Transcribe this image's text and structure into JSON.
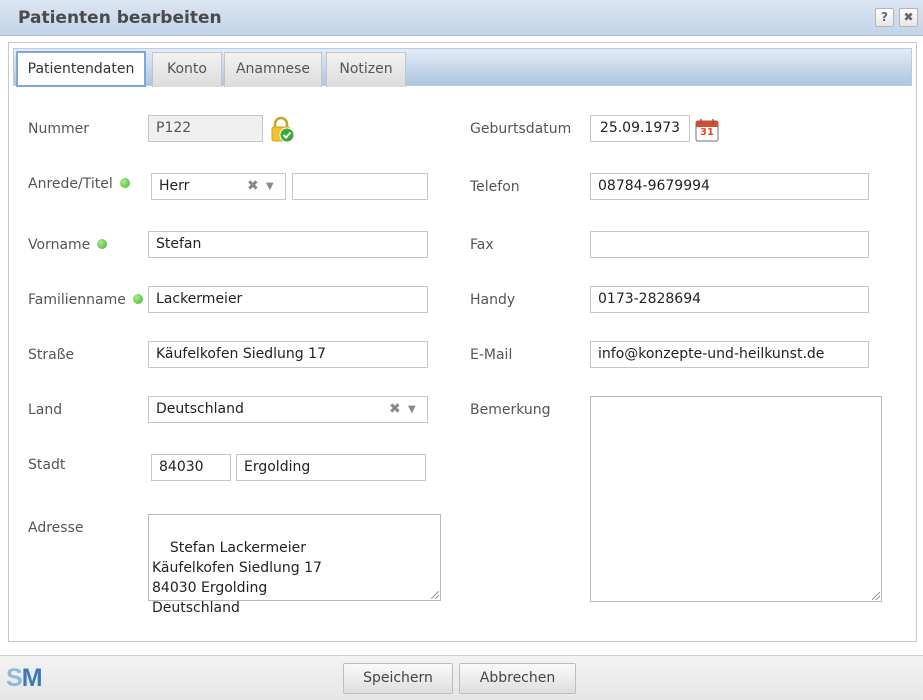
{
  "window": {
    "title": "Patienten bearbeiten",
    "help_label": "?",
    "close_label": "✖"
  },
  "tabs": [
    {
      "label": "Patientendaten",
      "active": true
    },
    {
      "label": "Konto",
      "active": false
    },
    {
      "label": "Anamnese",
      "active": false
    },
    {
      "label": "Notizen",
      "active": false
    }
  ],
  "form": {
    "nummer": {
      "label": "Nummer",
      "value": "P122"
    },
    "anrede": {
      "label": "Anrede/Titel",
      "value": "Herr",
      "titel_value": ""
    },
    "vorname": {
      "label": "Vorname",
      "value": "Stefan"
    },
    "familienname": {
      "label": "Familienname",
      "value": "Lackermeier"
    },
    "strasse": {
      "label": "Straße",
      "value": "Käufelkofen Siedlung 17"
    },
    "land": {
      "label": "Land",
      "value": "Deutschland"
    },
    "stadt": {
      "label": "Stadt",
      "plz": "84030",
      "ort": "Ergolding"
    },
    "adresse": {
      "label": "Adresse",
      "value": "Stefan Lackermeier\nKäufelkofen Siedlung 17\n84030 Ergolding\nDeutschland"
    },
    "geburtsdatum": {
      "label": "Geburtsdatum",
      "value": "25.09.1973",
      "calendar_day": "31"
    },
    "telefon": {
      "label": "Telefon",
      "value": "08784-9679994"
    },
    "fax": {
      "label": "Fax",
      "value": ""
    },
    "handy": {
      "label": "Handy",
      "value": "0173-2828694"
    },
    "email": {
      "label": "E-Mail",
      "value": "info@konzepte-und-heilkunst.de"
    },
    "bemerkung": {
      "label": "Bemerkung",
      "value": ""
    }
  },
  "combo_glyphs": {
    "clear": "✖",
    "arrow": "▼"
  },
  "footer": {
    "logo_s": "S",
    "logo_m": "M",
    "save_label": "Speichern",
    "cancel_label": "Abbrechen"
  },
  "colors": {
    "required_dot": "#3fb52a",
    "tab_active_border": "#7fa7d9",
    "logo_s": "#8fb8de",
    "logo_m": "#3f78b6"
  }
}
